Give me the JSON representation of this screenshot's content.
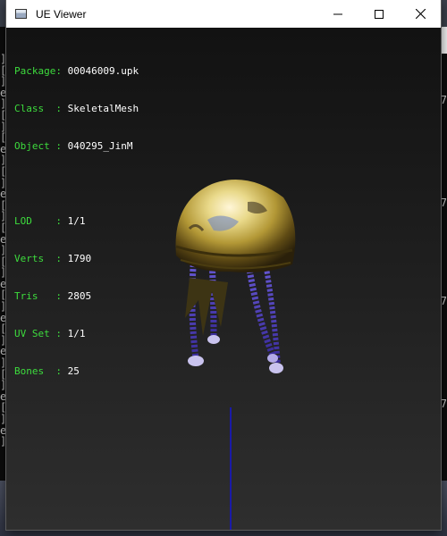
{
  "window": {
    "title": "UE Viewer",
    "controls": [
      "minimize",
      "maximize",
      "close"
    ]
  },
  "info_panel": {
    "package": {
      "label": "Package:",
      "value": "00046009.upk"
    },
    "class": {
      "label": "Class  :",
      "value": "SkeletalMesh"
    },
    "object": {
      "label": "Object :",
      "value": "040295_JinM"
    },
    "lod": {
      "label": "LOD    :",
      "value": "1/1"
    },
    "verts": {
      "label": "Verts  :",
      "value": "1790"
    },
    "tris": {
      "label": "Tris   :",
      "value": "2805"
    },
    "uvset": {
      "label": "UV Set :",
      "value": "1/1"
    },
    "bones": {
      "label": "Bones  :",
      "value": "25"
    }
  },
  "background_console": {
    "left_chars": [
      "]",
      "[",
      "]",
      "e",
      "]",
      "[",
      "]",
      "[",
      "e",
      "]",
      "[",
      "]",
      "e",
      "[",
      "]",
      "[",
      "e",
      "]",
      "[",
      "]",
      "e",
      "[",
      "]",
      "e",
      "[",
      "]",
      "e",
      "]",
      "[",
      "]",
      "e",
      "[",
      "]",
      "e",
      "]"
    ],
    "right_chars": [
      "7",
      "7",
      "7",
      "7"
    ]
  },
  "colors": {
    "label": "#3ddc3d",
    "value": "#ffffff",
    "axis": "#1a1aa8",
    "viewport_bg": "#1c1c1c"
  }
}
